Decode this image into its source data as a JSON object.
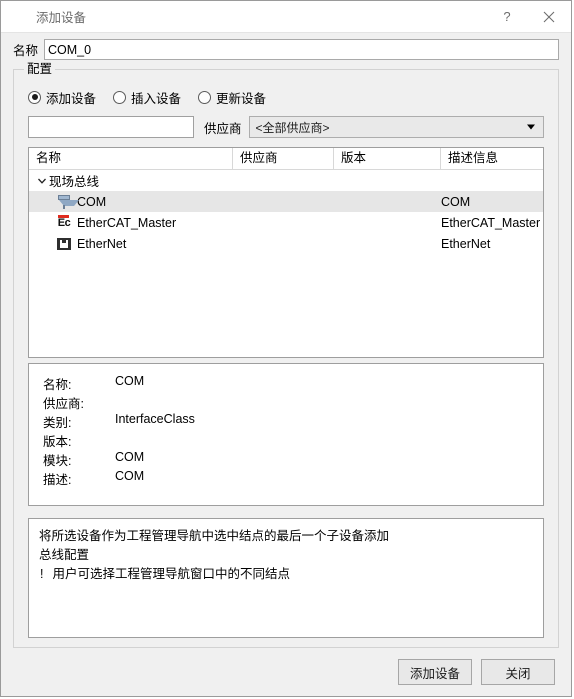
{
  "window": {
    "title": "添加设备",
    "help_icon": "question-mark-icon",
    "help_label": "?",
    "close_icon": "close-icon"
  },
  "name_field": {
    "label": "名称",
    "value": "COM_0",
    "placeholder": ""
  },
  "config_group": {
    "legend": "配置",
    "modes": [
      {
        "label": "添加设备",
        "checked": true
      },
      {
        "label": "插入设备",
        "checked": false
      },
      {
        "label": "更新设备",
        "checked": false
      }
    ],
    "filter": {
      "value": "",
      "placeholder": ""
    },
    "vendor": {
      "label": "供应商",
      "selected": "<全部供应商>",
      "options": [
        "<全部供应商>"
      ]
    }
  },
  "tree": {
    "columns": [
      "名称",
      "供应商",
      "版本",
      "描述信息"
    ],
    "rows": [
      {
        "level": 0,
        "expanded": true,
        "expander_icon": "chevron-down-icon",
        "icon": "none",
        "name": "现场总线",
        "vendor": "",
        "version": "",
        "description": "",
        "selected": false
      },
      {
        "level": 1,
        "expanded": false,
        "expander_icon": "",
        "icon": "serial-port-icon",
        "name": "COM",
        "vendor": "",
        "version": "",
        "description": "COM",
        "selected": true
      },
      {
        "level": 1,
        "expanded": false,
        "expander_icon": "",
        "icon": "ethercat-icon",
        "name": "EtherCAT_Master",
        "vendor": "",
        "version": "",
        "description": "EtherCAT_Master",
        "selected": false
      },
      {
        "level": 1,
        "expanded": false,
        "expander_icon": "",
        "icon": "ethernet-jack-icon",
        "name": "EtherNet",
        "vendor": "",
        "version": "",
        "description": "EtherNet",
        "selected": false
      }
    ]
  },
  "details": [
    {
      "key": "名称:",
      "value": "COM"
    },
    {
      "key": "供应商:",
      "value": ""
    },
    {
      "key": "类别:",
      "value": "InterfaceClass"
    },
    {
      "key": "版本:",
      "value": ""
    },
    {
      "key": "模块:",
      "value": "COM"
    },
    {
      "key": "描述:",
      "value": "COM"
    }
  ],
  "info": {
    "line1": "将所选设备作为工程管理导航中选中结点的最后一个子设备添加",
    "line2": "总线配置",
    "hint_marker": "!",
    "line3": "用户可选择工程管理导航窗口中的不同结点"
  },
  "footer": {
    "primary_label": "添加设备",
    "close_label": "关闭"
  },
  "colors": {
    "dialog_bg": "#f0f0f0",
    "titlebar_bg": "#ffffff",
    "field_bg": "#ffffff",
    "selection_bg": "#e6e6e6",
    "border": "#9e9e9e",
    "text": "#000000",
    "title_text": "#6b6b6b",
    "ethercat_red": "#e02b1e",
    "serial_blue": "#9fb6cf"
  }
}
